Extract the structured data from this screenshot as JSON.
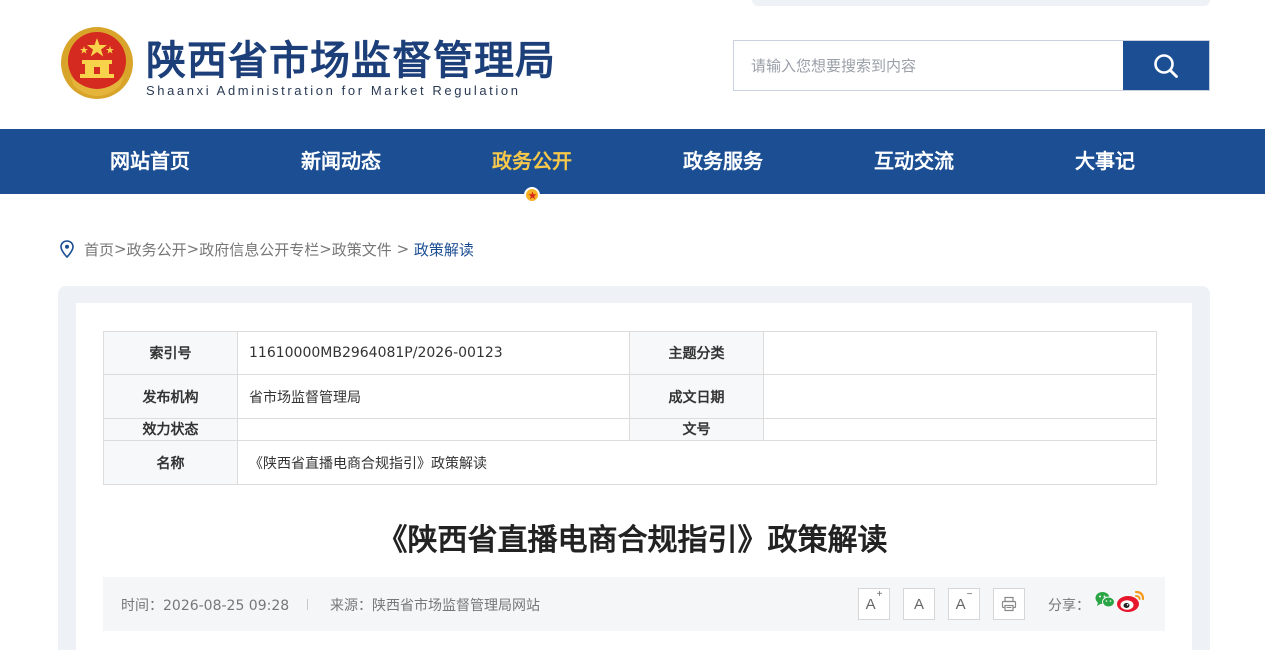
{
  "header": {
    "title": "陕西省市场监督管理局",
    "subtitle": "Shaanxi Administration for Market Regulation",
    "search_placeholder": "请输入您想要搜索到内容"
  },
  "nav": {
    "items": [
      {
        "label": "网站首页"
      },
      {
        "label": "新闻动态"
      },
      {
        "label": "政务公开"
      },
      {
        "label": "政务服务"
      },
      {
        "label": "互动交流"
      },
      {
        "label": "大事记"
      }
    ],
    "active_index": 2
  },
  "breadcrumb": {
    "items": [
      "首页",
      "政务公开",
      "政府信息公开专栏",
      "政策文件"
    ],
    "current": "政策解读"
  },
  "info": {
    "index_label": "索引号",
    "index_value": "11610000MB2964081P/2026-00123",
    "topic_label": "主题分类",
    "topic_value": "",
    "publisher_label": "发布机构",
    "publisher_value": "省市场监督管理局",
    "date_label": "成文日期",
    "date_value": "",
    "status_label": "效力状态",
    "status_value": "",
    "docno_label": "文号",
    "docno_value": "",
    "name_label": "名称",
    "name_value": "《陕西省直播电商合规指引》政策解读"
  },
  "article": {
    "title": "《陕西省直播电商合规指引》政策解读",
    "time": "时间：2026-08-25 09:28",
    "source": "来源：陕西省市场监督管理局网站",
    "font_large": "A",
    "font_normal": "A",
    "font_small": "A",
    "share_label": "分享："
  },
  "colors": {
    "primary": "#1b4e93",
    "active_nav": "#f7c84a",
    "wechat": "#2aa545",
    "weibo": "#e6162d"
  }
}
